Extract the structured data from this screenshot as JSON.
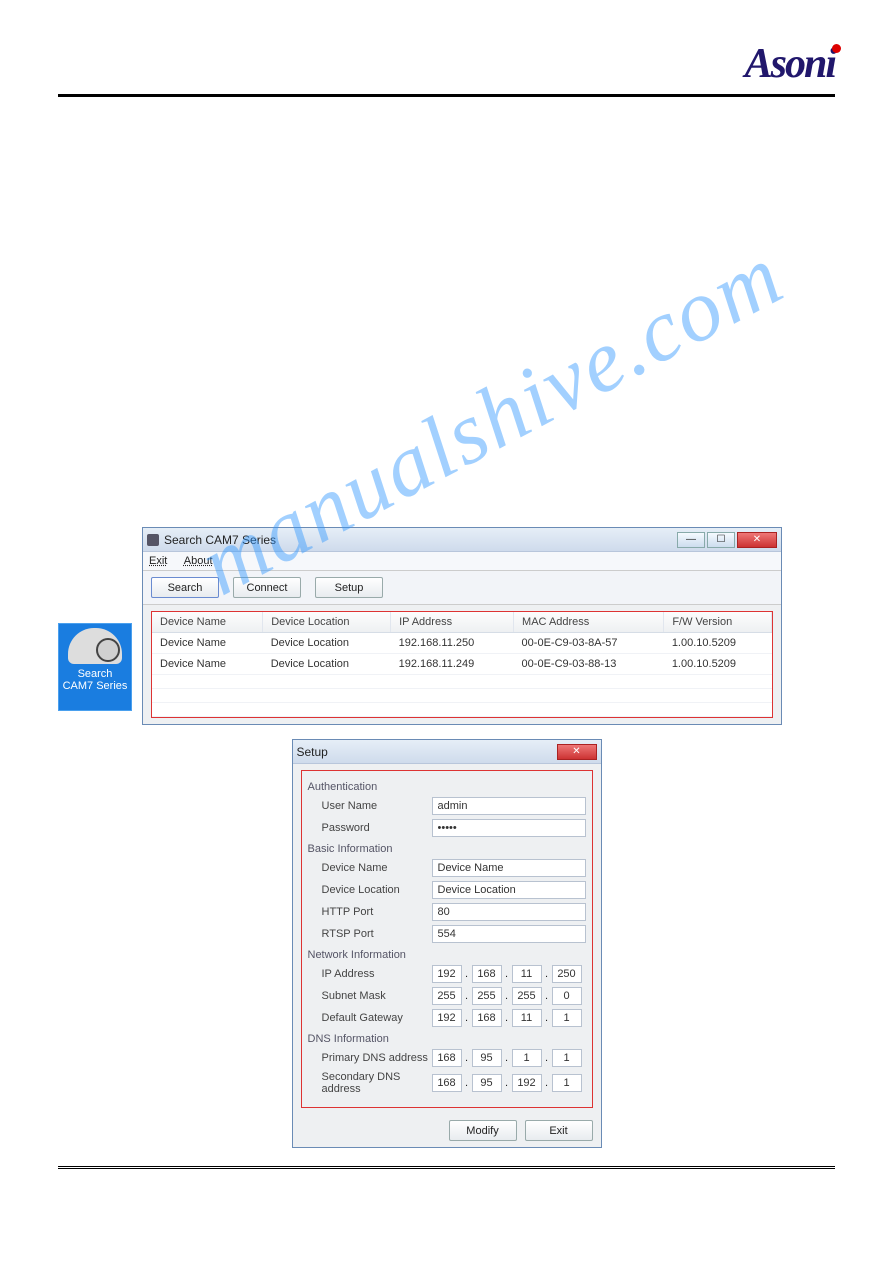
{
  "brand": "Asoni",
  "watermark": "manualshive.com",
  "desktop_icon": {
    "line1": "Search",
    "line2": "CAM7 Series"
  },
  "search_window": {
    "title": "Search CAM7 Series",
    "menu": {
      "exit": "Exit",
      "about": "About"
    },
    "buttons": {
      "search": "Search",
      "connect": "Connect",
      "setup": "Setup"
    },
    "columns": [
      "Device Name",
      "Device Location",
      "IP Address",
      "MAC Address",
      "F/W Version"
    ],
    "rows": [
      [
        "Device Name",
        "Device Location",
        "192.168.11.250",
        "00-0E-C9-03-8A-57",
        "1.00.10.5209"
      ],
      [
        "Device Name",
        "Device Location",
        "192.168.11.249",
        "00-0E-C9-03-88-13",
        "1.00.10.5209"
      ]
    ]
  },
  "setup_window": {
    "title": "Setup",
    "auth_title": "Authentication",
    "auth": {
      "user_label": "User Name",
      "user_value": "admin",
      "pass_label": "Password",
      "pass_value": "•••••"
    },
    "basic_title": "Basic Information",
    "basic": {
      "devname_label": "Device Name",
      "devname_value": "Device Name",
      "devloc_label": "Device Location",
      "devloc_value": "Device Location",
      "http_label": "HTTP Port",
      "http_value": "80",
      "rtsp_label": "RTSP Port",
      "rtsp_value": "554"
    },
    "net_title": "Network Information",
    "net": {
      "ip_label": "IP Address",
      "ip": [
        "192",
        "168",
        "11",
        "250"
      ],
      "mask_label": "Subnet Mask",
      "mask": [
        "255",
        "255",
        "255",
        "0"
      ],
      "gw_label": "Default Gateway",
      "gw": [
        "192",
        "168",
        "11",
        "1"
      ]
    },
    "dns_title": "DNS Information",
    "dns": {
      "primary_label": "Primary DNS address",
      "primary": [
        "168",
        "95",
        "1",
        "1"
      ],
      "secondary_label": "Secondary DNS address",
      "secondary": [
        "168",
        "95",
        "192",
        "1"
      ]
    },
    "footer": {
      "modify": "Modify",
      "exit": "Exit"
    }
  }
}
